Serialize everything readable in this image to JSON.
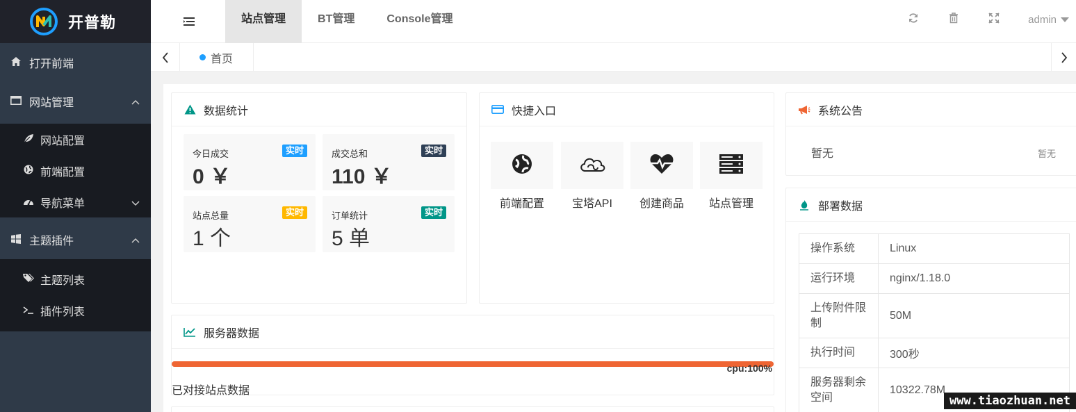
{
  "brand": {
    "name": "开普勒",
    "accent": "#1e9fff",
    "orange": "#ef6533"
  },
  "sidebar": {
    "items": [
      {
        "label": "打开前端",
        "icon": "home-icon"
      },
      {
        "label": "网站管理",
        "icon": "window-icon",
        "expanded": true,
        "children": [
          {
            "label": "网站配置",
            "icon": "leaf-icon"
          },
          {
            "label": "前端配置",
            "icon": "globe-icon"
          },
          {
            "label": "导航菜单",
            "icon": "dashboard-icon"
          }
        ]
      },
      {
        "label": "主题插件",
        "icon": "windows-icon",
        "expanded": true,
        "children": [
          {
            "label": "主题列表",
            "icon": "tags-icon"
          },
          {
            "label": "插件列表",
            "icon": "terminal-icon"
          }
        ]
      }
    ]
  },
  "header": {
    "tabs": [
      "站点管理",
      "BT管理",
      "Console管理"
    ],
    "active_tab": "站点管理",
    "user": "admin"
  },
  "tabbar": {
    "home": "首页"
  },
  "stats": {
    "title": "数据统计",
    "cards": [
      {
        "label": "今日成交",
        "value": "0 ￥",
        "badge": "实时",
        "badge_color": "#1e9fff"
      },
      {
        "label": "成交总和",
        "value": "110 ￥",
        "badge": "实时",
        "badge_color": "#2f4056"
      },
      {
        "label": "站点总量",
        "value": "1 个",
        "badge": "实时",
        "badge_color": "#ffb800"
      },
      {
        "label": "订单统计",
        "value": "5 单",
        "badge": "实时",
        "badge_color": "#009688"
      }
    ]
  },
  "quick": {
    "title": "快捷入口",
    "items": [
      {
        "label": "前端配置",
        "icon": "globe-icon"
      },
      {
        "label": "宝塔API",
        "icon": "cloud-icon"
      },
      {
        "label": "创建商品",
        "icon": "heartbeat-icon"
      },
      {
        "label": "站点管理",
        "icon": "server-icon"
      }
    ]
  },
  "notice": {
    "title": "系统公告",
    "text": "暂无",
    "meta": "暂无"
  },
  "server": {
    "title": "服务器数据",
    "cpu_label": "cpu:100%",
    "cpu_percent": 100,
    "note": "已对接站点数据"
  },
  "deploy": {
    "title": "部署数据",
    "rows": [
      {
        "k": "操作系统",
        "v": "Linux"
      },
      {
        "k": "运行环境",
        "v": "nginx/1.18.0"
      },
      {
        "k": "上传附件限制",
        "v": "50M"
      },
      {
        "k": "执行时间",
        "v": "300秒"
      },
      {
        "k": "服务器剩余空间",
        "v": "10322.78M"
      }
    ]
  },
  "watermark": "www.tiaozhuan.net"
}
